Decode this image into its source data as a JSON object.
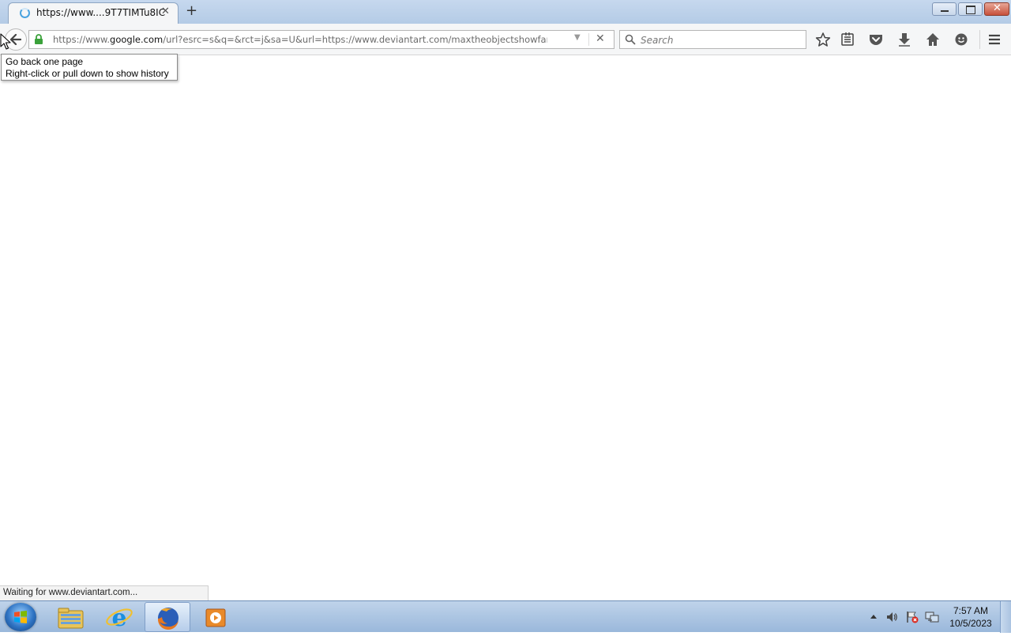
{
  "browser": {
    "tab": {
      "title": "https://www....9T7TIMTu8IC",
      "close_glyph": "✕"
    },
    "new_tab_glyph": "+",
    "url": {
      "prefix": "https://www.",
      "domain": "google.com",
      "rest": "/url?esrc=s&q=&rct=j&sa=U&url=https://www.deviantart.com/maxtheobjectshowfan/art/bfdi-w",
      "stop_glyph": "✕"
    },
    "search": {
      "placeholder": "Search"
    },
    "toolbar_icons": [
      "star-icon",
      "reading-list-icon",
      "pocket-icon",
      "download-icon",
      "home-icon",
      "hello-chat-icon",
      "menu-icon"
    ],
    "tooltip": {
      "line1": "Go back one page",
      "line2": "Right-click or pull down to show history"
    },
    "status": "Waiting for www.deviantart.com..."
  },
  "taskbar": {
    "apps": [
      "file-explorer-icon",
      "internet-explorer-icon",
      "firefox-icon",
      "media-player-icon"
    ],
    "clock": {
      "time": "7:57 AM",
      "date": "10/5/2023"
    }
  },
  "colors": {
    "titlebar": "#c6d8ee",
    "toolbar": "#f5f6f7",
    "taskbar": "#9ab8db",
    "lock": "#3aa13a"
  }
}
